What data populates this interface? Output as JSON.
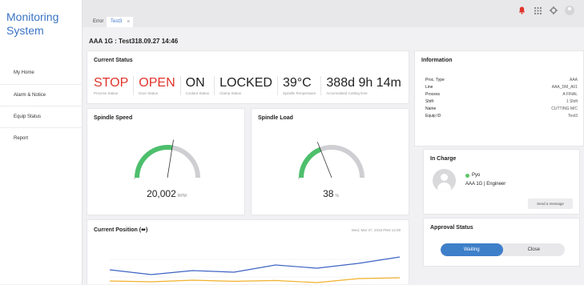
{
  "app": {
    "title_line1": "Monitoring",
    "title_line2": "System"
  },
  "sidebar": {
    "items": [
      {
        "label": "My Home"
      },
      {
        "label": "Alarm & Notice"
      },
      {
        "label": "Equip Status"
      },
      {
        "label": "Report"
      }
    ]
  },
  "tabs": [
    {
      "label": "Error"
    },
    {
      "label": "Test3"
    }
  ],
  "tab_close": "×",
  "equipment": {
    "title": "AAA 1G : Test318.09.27 14:46"
  },
  "current_status": {
    "title": "Current Status",
    "stats": [
      {
        "value": "STOP",
        "label": "Process Status"
      },
      {
        "value": "OPEN",
        "label": "Door Status"
      },
      {
        "value": "ON",
        "label": "Coolant Status"
      },
      {
        "value": "LOCKED",
        "label": "Clamp Status"
      },
      {
        "value": "39°C",
        "label": "Spindle Temperature"
      },
      {
        "value": "388d 9h 14m",
        "label": "Accumulated Cutting time"
      }
    ]
  },
  "spindle_speed": {
    "title": "Spindle Speed",
    "value": "20,002",
    "unit": "RPM",
    "min": "0",
    "max": "",
    "level": 0.55
  },
  "spindle_load": {
    "title": "Spindle Load",
    "value": "38",
    "unit": "%",
    "min": "0",
    "max": "",
    "level": 0.38
  },
  "current_position": {
    "title": "Current Position (",
    "date": "Wed, Mar 07, 2018  PM4:14:09",
    "ylabels": [
      "",
      "",
      ""
    ]
  },
  "chart_data": {
    "type": "line",
    "x": [
      0,
      1,
      2,
      3,
      4,
      5,
      6,
      7
    ],
    "series": [
      {
        "values": [
          450,
          420,
          445,
          435,
          480,
          460,
          490,
          530
        ],
        "color": "#3f63c4"
      },
      {
        "values": [
          380,
          375,
          385,
          378,
          383,
          370,
          395,
          400
        ],
        "color": "#f2b12c"
      }
    ]
  },
  "information": {
    "title": "Information",
    "rows": [
      {
        "key": "Proc. Type",
        "value": "AAA"
      },
      {
        "key": "Line",
        "value": "AAA_DM_A01"
      },
      {
        "key": "Process",
        "value": "A FINAL"
      },
      {
        "key": "Shift",
        "value": "1 Shift"
      },
      {
        "key": "Name",
        "value": "CUTTING M/C"
      },
      {
        "key": "Equip ID",
        "value": "Test3"
      }
    ]
  },
  "in_charge": {
    "title": "In Charge",
    "name": "Pyo",
    "role": "AAA 1G | Engineer",
    "button": "Send a message"
  },
  "approval": {
    "title": "Approval Status",
    "options": [
      "Waiting",
      "Close"
    ]
  },
  "colors": {
    "accent": "#3b74c6",
    "alert": "#e0342b",
    "gauge_green": "#4dbf6c",
    "gauge_track": "#cfcfd3"
  },
  "icons": [
    "bell-icon",
    "grid-icon",
    "gear-icon",
    "user-icon"
  ]
}
